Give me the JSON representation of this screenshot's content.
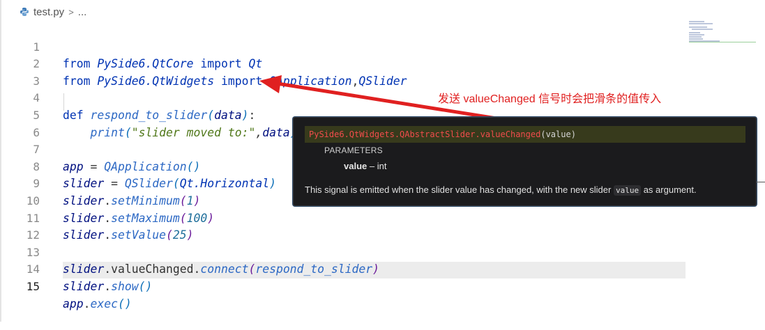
{
  "breadcrumb": {
    "file": "test.py",
    "separator": ">",
    "ellipsis": "..."
  },
  "code": {
    "lines": [
      {
        "n": "1"
      },
      {
        "n": "2"
      },
      {
        "n": "3"
      },
      {
        "n": "4"
      },
      {
        "n": "5"
      },
      {
        "n": "6"
      },
      {
        "n": "7"
      },
      {
        "n": "8"
      },
      {
        "n": "9"
      },
      {
        "n": "10"
      },
      {
        "n": "11"
      },
      {
        "n": "12"
      },
      {
        "n": "13"
      },
      {
        "n": "14"
      },
      {
        "n": "15"
      }
    ],
    "active_line": "15"
  },
  "tokens": {
    "from": "from",
    "import": "import",
    "def": "def",
    "mod_core": "PySide6.QtCore",
    "mod_widgets": "PySide6.QtWidgets",
    "qt": "Qt",
    "qapp": "QApplication",
    "comma": ",",
    "qslider": "QSlider",
    "fn_name": "respond_to_slider",
    "param": "data",
    "print": "print",
    "str": "\"slider moved to:\"",
    "app": "app",
    "eq": " = ",
    "slider": "slider",
    "qt_h": "Qt.Horizontal",
    "setMinimum": "setMinimum",
    "setMaximum": "setMaximum",
    "setValue": "setValue",
    "v1": "1",
    "v100": "100",
    "v25": "25",
    "valueChanged_connect": "valueChanged",
    "connect": "connect",
    "show": "show",
    "exec": "exec"
  },
  "hover": {
    "signature_path": "PySide6.QtWidgets.QAbstractSlider.valueChanged",
    "signature_args": "(value)",
    "params_heading": "PARAMETERS",
    "param_name": "value",
    "param_desc": " – int",
    "desc_before": "This signal is emitted when the slider value has changed, with the new slider ",
    "desc_code": "value",
    "desc_after": " as argument."
  },
  "annotation": {
    "text": "发送 valueChanged 信号时会把滑条的值传入",
    "color": "#e02020"
  },
  "colors": {
    "keyword": "#0033b3",
    "function": "#2c68c4",
    "string": "#50781a",
    "annotation": "#e02020",
    "hover_bg": "#1b1b1d"
  },
  "icons": {
    "file_icon": "python-file-icon"
  }
}
